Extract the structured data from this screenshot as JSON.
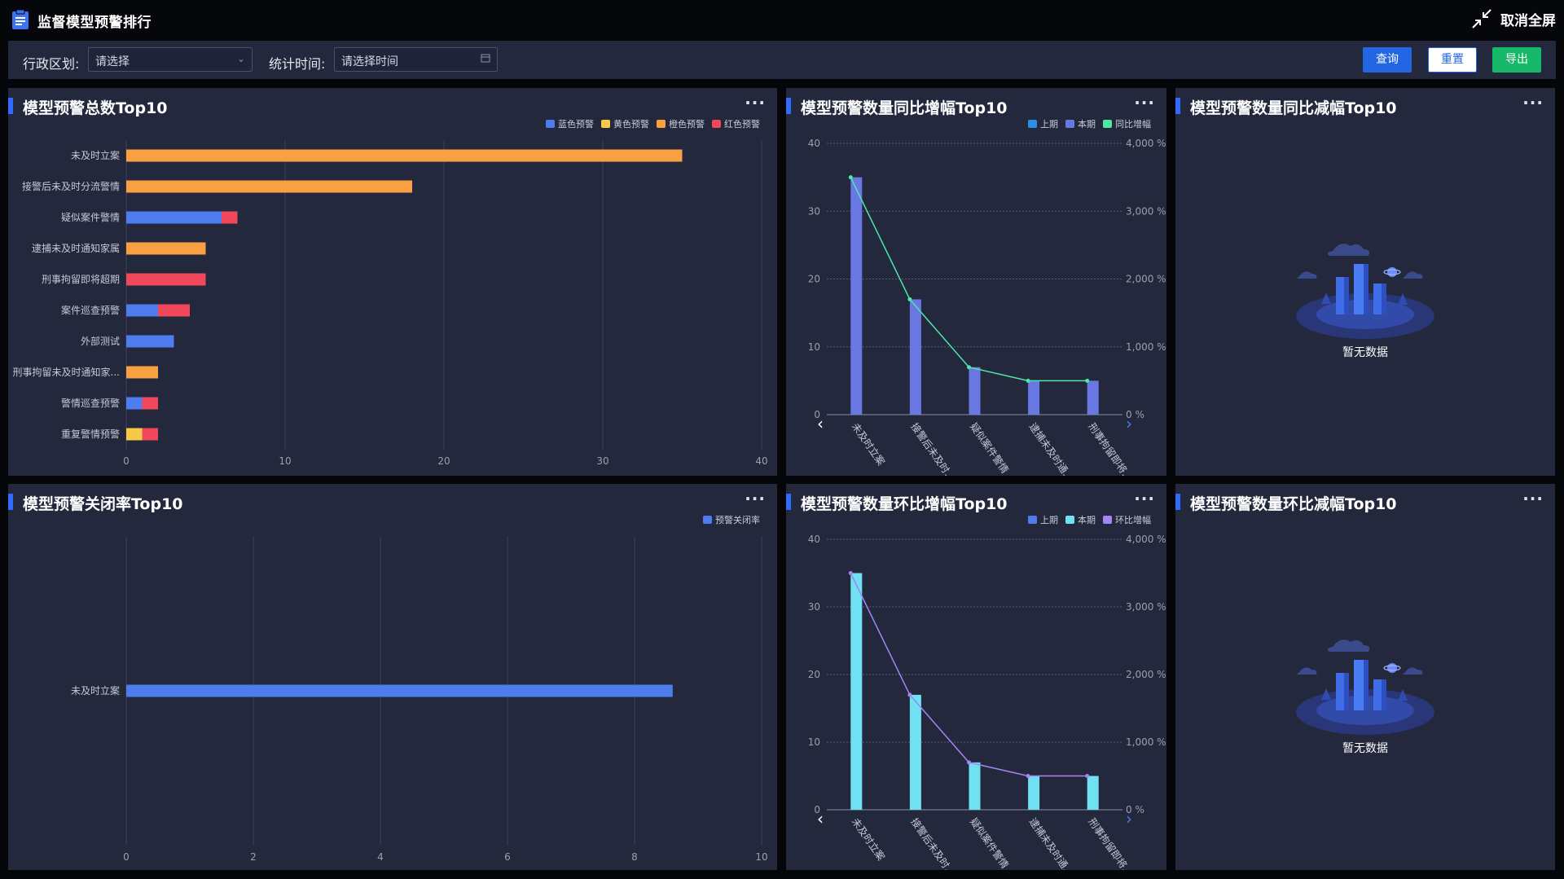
{
  "app": {
    "title": "监督模型预警排行",
    "exit_fullscreen": "取消全屏"
  },
  "filters": {
    "region_label": "行政区划:",
    "region_placeholder": "请选择",
    "time_label": "统计时间:",
    "time_placeholder": "请选择时间",
    "query_label": "查询",
    "reset_label": "重置",
    "export_label": "导出"
  },
  "panels": {
    "total_top10": {
      "title": "模型预警总数Top10"
    },
    "yoy_increase": {
      "title": "模型预警数量同比增幅Top10"
    },
    "yoy_decrease": {
      "title": "模型预警数量同比减幅Top10",
      "empty_text": "暂无数据"
    },
    "close_rate": {
      "title": "模型预警关闭率Top10"
    },
    "mom_increase": {
      "title": "模型预警数量环比增幅Top10"
    },
    "mom_decrease": {
      "title": "模型预警数量环比减幅Top10",
      "empty_text": "暂无数据"
    }
  },
  "chart_data": [
    {
      "id": "total",
      "type": "bar",
      "orientation": "horizontal",
      "stacked": true,
      "categories": [
        "未及时立案",
        "接警后未及时分流警情",
        "疑似案件警情",
        "逮捕未及时通知家属",
        "刑事拘留即将超期",
        "案件巡查预警",
        "外部测试",
        "刑事拘留未及时通知家...",
        "警情巡查预警",
        "重复警情预警"
      ],
      "series": [
        {
          "name": "蓝色预警",
          "color": "#4f7df0",
          "values": [
            0,
            0,
            6,
            0,
            0,
            2,
            3,
            0,
            1,
            0
          ]
        },
        {
          "name": "黄色预警",
          "color": "#f7c948",
          "values": [
            0,
            0,
            0,
            0,
            0,
            0,
            0,
            0,
            0,
            1
          ]
        },
        {
          "name": "橙色预警",
          "color": "#f8a042",
          "values": [
            35,
            18,
            0,
            5,
            0,
            0,
            0,
            2,
            0,
            0
          ]
        },
        {
          "name": "红色预警",
          "color": "#f0485a",
          "values": [
            0,
            0,
            1,
            0,
            5,
            2,
            0,
            0,
            1,
            1
          ]
        }
      ],
      "xlim": [
        0,
        40
      ],
      "xticks": [
        "0",
        "10",
        "20",
        "30",
        "40"
      ],
      "legend": "top-right",
      "grid": true
    },
    {
      "id": "yoy",
      "type": "bar",
      "categories": [
        "未及时立案",
        "接警后未及时...",
        "疑似案件警情",
        "逮捕未及时通...",
        "刑事拘留即将..."
      ],
      "series": [
        {
          "name": "上期",
          "color": "#2b8fe8",
          "values": [
            0,
            0,
            0,
            0,
            0
          ]
        },
        {
          "name": "本期",
          "color": "#6a78e3",
          "values": [
            35,
            17,
            7,
            5,
            5
          ]
        },
        {
          "name": "同比增幅",
          "type": "line",
          "color": "#4ee7a4",
          "values": [
            3500,
            1700,
            700,
            500,
            500
          ]
        }
      ],
      "ylim": [
        0,
        40
      ],
      "yticks": [
        "0",
        "10",
        "20",
        "30",
        "40"
      ],
      "y2ticks": [
        "0 %",
        "1,000 %",
        "2,000 %",
        "3,000 %",
        "4,000 %"
      ],
      "y2lim": [
        0,
        4000
      ],
      "legend": "top-right",
      "grid": true
    },
    {
      "id": "close",
      "type": "bar",
      "orientation": "horizontal",
      "categories": [
        "未及时立案"
      ],
      "series": [
        {
          "name": "预警关闭率",
          "color": "#4f7df0",
          "values": [
            8.6
          ]
        }
      ],
      "xlim": [
        0,
        10
      ],
      "xticks": [
        "0",
        "2",
        "4",
        "6",
        "8",
        "10"
      ],
      "legend": "top-right",
      "grid": true
    },
    {
      "id": "mom",
      "type": "bar",
      "categories": [
        "未及时立案",
        "接警后未及时...",
        "疑似案件警情",
        "逮捕未及时通...",
        "刑事拘留即将..."
      ],
      "series": [
        {
          "name": "上期",
          "color": "#4f7df0",
          "values": [
            0,
            0,
            0,
            0,
            0
          ]
        },
        {
          "name": "本期",
          "color": "#6fe1f2",
          "values": [
            35,
            17,
            7,
            5,
            5
          ]
        },
        {
          "name": "环比增幅",
          "type": "line",
          "color": "#a585f3",
          "values": [
            3500,
            1700,
            700,
            500,
            500
          ]
        }
      ],
      "ylim": [
        0,
        40
      ],
      "yticks": [
        "0",
        "10",
        "20",
        "30",
        "40"
      ],
      "y2ticks": [
        "0 %",
        "1,000 %",
        "2,000 %",
        "3,000 %",
        "4,000 %"
      ],
      "y2lim": [
        0,
        4000
      ],
      "legend": "top-right",
      "grid": true
    }
  ]
}
